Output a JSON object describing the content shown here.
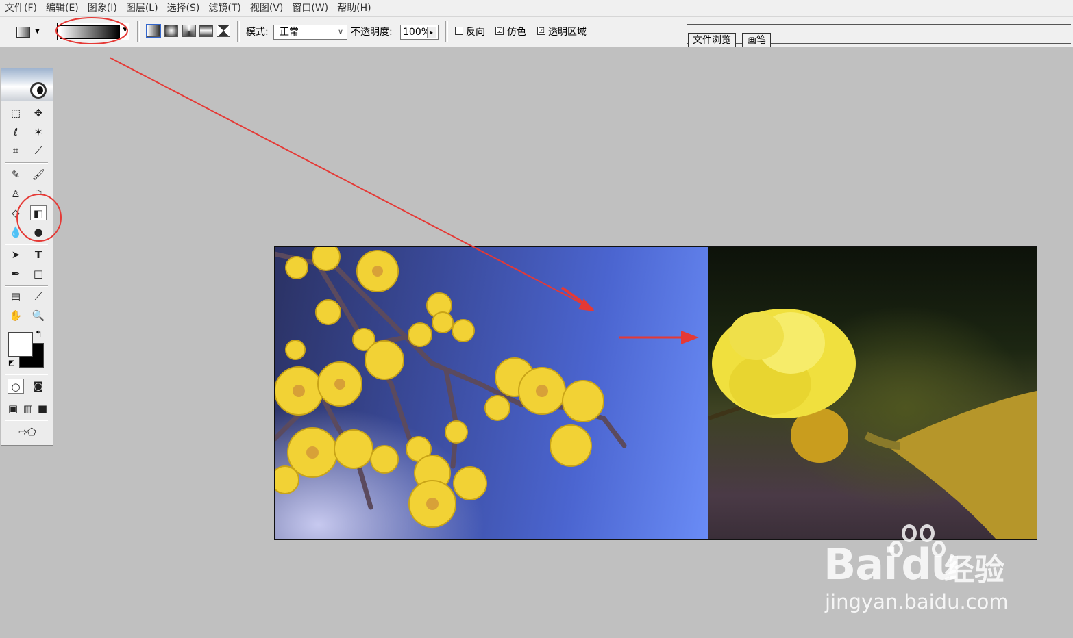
{
  "menubar": {
    "items": [
      "文件(F)",
      "编辑(E)",
      "图象(I)",
      "图层(L)",
      "选择(S)",
      "滤镜(T)",
      "视图(V)",
      "窗口(W)",
      "帮助(H)"
    ]
  },
  "options": {
    "mode_label": "模式:",
    "mode_value": "正常",
    "opacity_label": "不透明度:",
    "opacity_value": "100%",
    "reverse_label": "反向",
    "dither_label": "仿色",
    "transparency_label": "透明区域",
    "reverse_checked": false,
    "dither_checked": true,
    "transparency_checked": true,
    "check_mark": "☑",
    "tabs": [
      "文件浏览",
      "画笔"
    ]
  },
  "toolbox": {
    "foreground_color": "#ffffff",
    "background_color": "#000000"
  },
  "annotations": {
    "color": "#e53935"
  },
  "watermark": {
    "brand": "Bai",
    "brand_tail": "du",
    "cn": "经验",
    "url": "jingyan.baidu.com"
  }
}
